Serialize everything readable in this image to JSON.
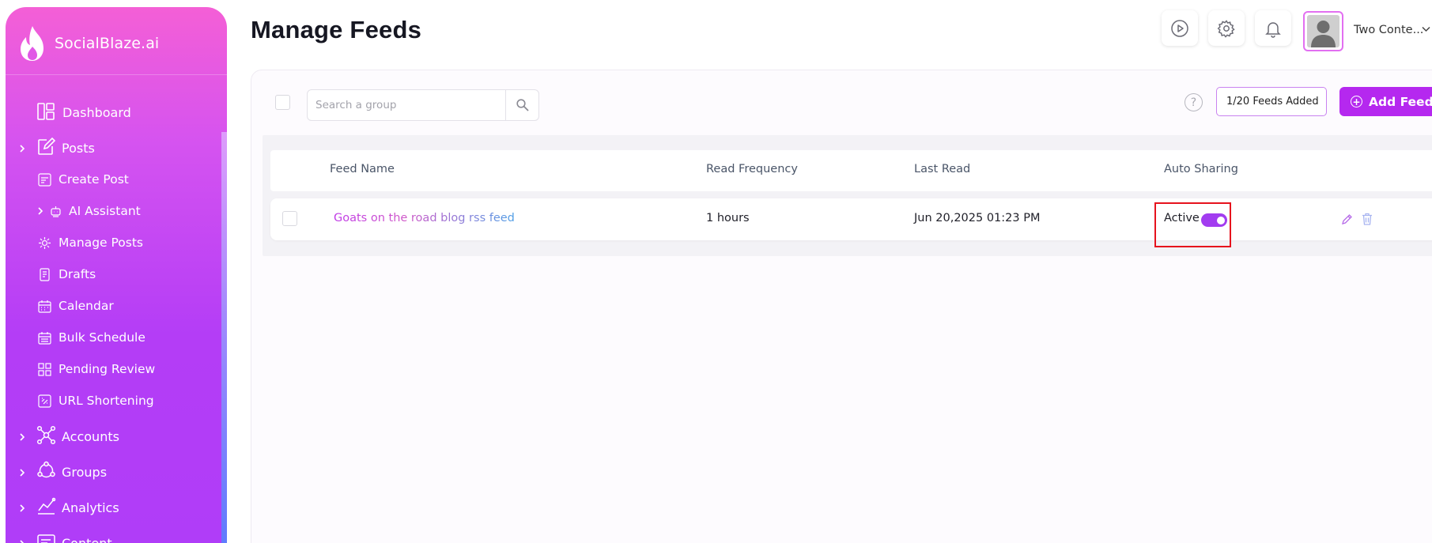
{
  "brand": {
    "name": "SocialBlaze.ai"
  },
  "sidebar": {
    "items": [
      {
        "label": "Dashboard",
        "icon": "dashboard-icon",
        "expandable": false
      },
      {
        "label": "Posts",
        "icon": "edit-icon",
        "expandable": true
      },
      {
        "label": "Create Post",
        "icon": "create-post-icon",
        "expandable": false,
        "sub": true
      },
      {
        "label": "AI Assistant",
        "icon": "robot-icon",
        "expandable": true,
        "sub": true
      },
      {
        "label": "Manage Posts",
        "icon": "manage-posts-icon",
        "expandable": false,
        "sub": true
      },
      {
        "label": "Drafts",
        "icon": "drafts-icon",
        "expandable": false,
        "sub": true
      },
      {
        "label": "Calendar",
        "icon": "calendar-icon",
        "expandable": false,
        "sub": true
      },
      {
        "label": "Bulk Schedule",
        "icon": "bulk-schedule-icon",
        "expandable": false,
        "sub": true
      },
      {
        "label": "Pending Review",
        "icon": "pending-review-icon",
        "expandable": false,
        "sub": true
      },
      {
        "label": "URL Shortening",
        "icon": "url-shortening-icon",
        "expandable": false,
        "sub": true
      },
      {
        "label": "Accounts",
        "icon": "accounts-network-icon",
        "expandable": true
      },
      {
        "label": "Groups",
        "icon": "groups-icon",
        "expandable": true
      },
      {
        "label": "Analytics",
        "icon": "analytics-icon",
        "expandable": true
      },
      {
        "label": "Content",
        "icon": "content-icon",
        "expandable": true
      }
    ]
  },
  "header": {
    "title": "Manage Feeds",
    "buttons": [
      "play-icon",
      "gear-icon",
      "bell-icon"
    ],
    "user_name": "Two Conte..."
  },
  "toolbar": {
    "search_placeholder": "Search a group",
    "feeds_count": "1/20 Feeds Added",
    "add_feed_label": "Add Feed",
    "help_symbol": "?"
  },
  "table": {
    "columns": [
      "Feed Name",
      "Read Frequency",
      "Last Read",
      "Auto Sharing"
    ],
    "rows": [
      {
        "feed_name": "Goats on the road blog rss feed",
        "read_frequency": "1 hours",
        "last_read": "Jun 20,2025 01:23 PM",
        "auto_sharing_label": "Active",
        "auto_sharing_on": true
      }
    ]
  },
  "colors": {
    "brand_gradient_top": "#f45fd6",
    "brand_gradient_bottom": "#b03df8",
    "accent": "#b528ef",
    "highlight": "#e6121d"
  }
}
